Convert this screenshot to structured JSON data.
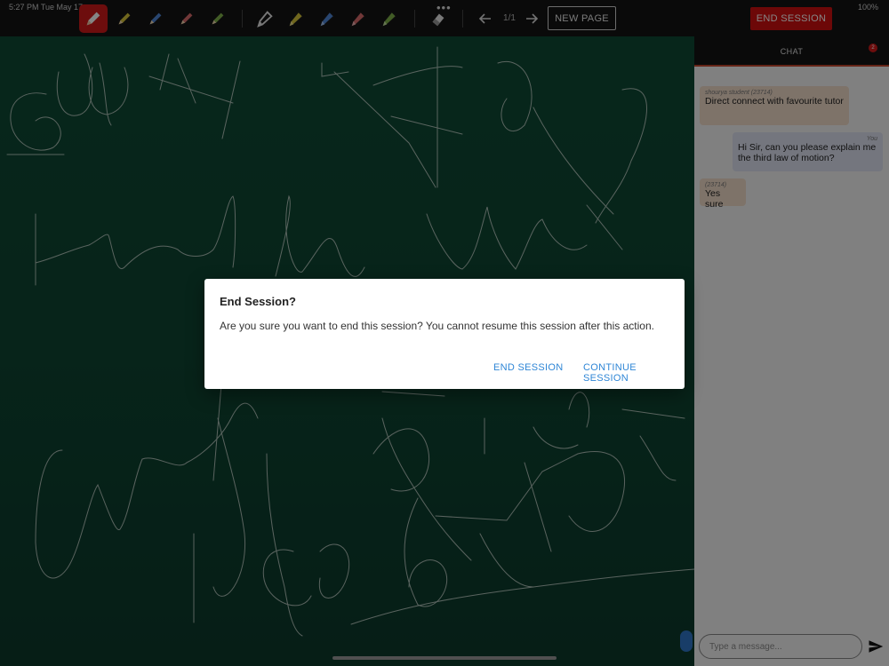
{
  "status_bar": {
    "time": "5:27 PM  Tue May 17",
    "battery": "100%"
  },
  "toolbar": {
    "colors": {
      "active_bg": "#d11a1a",
      "yellow": "#d6c53a",
      "blue": "#4f86d6",
      "red": "#d96b6b",
      "green": "#7fb14a",
      "white": "#e6e6e6"
    },
    "page_indicator": "1/1",
    "new_page_label": "NEW PAGE",
    "end_session_label": "END SESSION",
    "icons": [
      "pencil-icon",
      "pencil-icon",
      "pencil-icon",
      "pencil-icon",
      "pencil-icon",
      "marker-icon",
      "marker-icon",
      "marker-icon",
      "marker-icon",
      "marker-icon",
      "eraser-icon",
      "more-dots-icon",
      "arrow-left-icon",
      "arrow-right-icon"
    ]
  },
  "chat": {
    "title": "CHAT",
    "unread_count": "2",
    "messages": [
      {
        "sender": "shourya student  (23714)",
        "text": "Direct connect with favourite tutor",
        "from": "them"
      },
      {
        "sender": "You",
        "text": "Hi Sir, can you please explain me the third law of motion?",
        "from": "me"
      },
      {
        "sender": "(23714)",
        "text": "Yes sure",
        "from": "them"
      }
    ],
    "input_placeholder": "Type a message...",
    "send_icon": "send-icon"
  },
  "dialog": {
    "title": "End Session?",
    "body": "Are you sure you want to end this session? You cannot resume this session after this action.",
    "end_button": "END SESSION",
    "continue_button": "CONTINUE SESSION"
  }
}
